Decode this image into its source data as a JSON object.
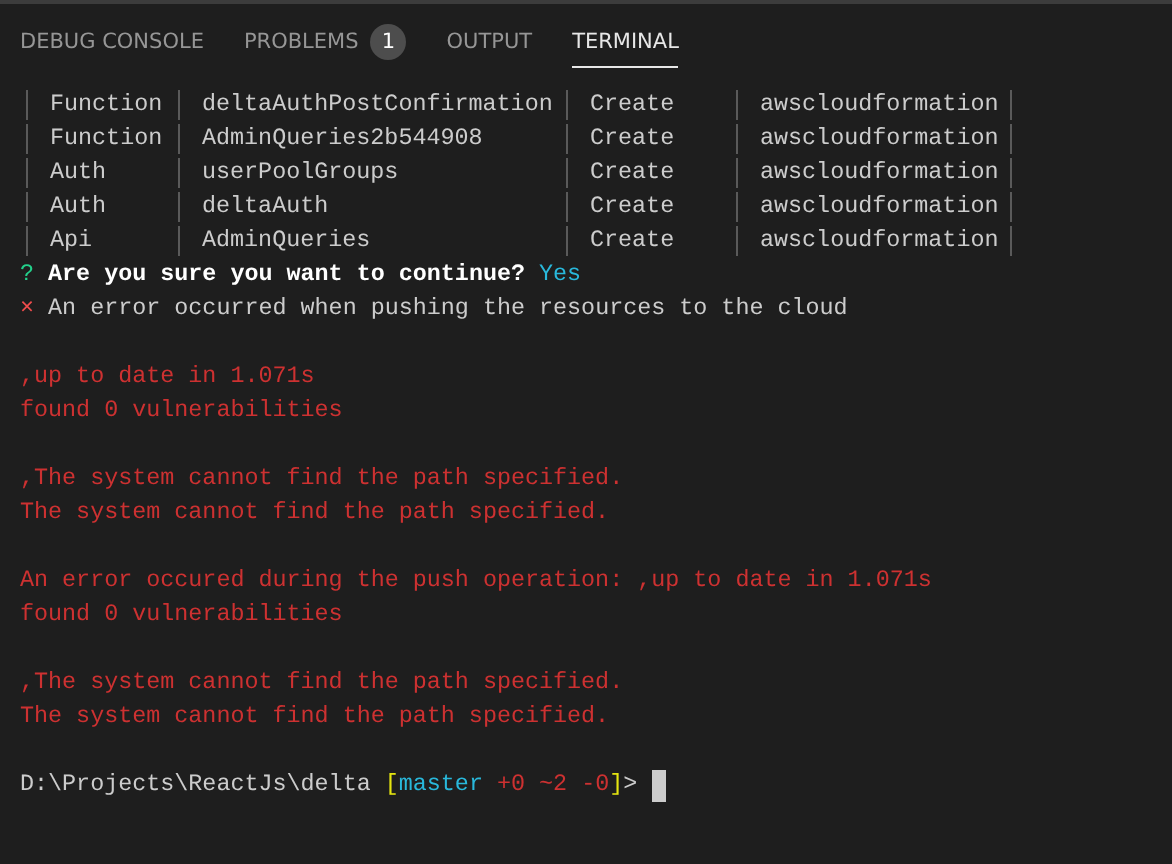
{
  "tabs": [
    {
      "label": "DEBUG CONSOLE",
      "selected": false
    },
    {
      "label": "PROBLEMS",
      "selected": false,
      "badge": "1"
    },
    {
      "label": "OUTPUT",
      "selected": false
    },
    {
      "label": "TERMINAL",
      "selected": true
    }
  ],
  "terminal": {
    "lines": [
      {
        "kind": "table_row",
        "cells": [
          "Function",
          "deltaAuthPostConfirmation",
          "Create",
          "awscloudformation"
        ]
      },
      {
        "kind": "table_row",
        "cells": [
          "Function",
          "AdminQueries2b544908",
          "Create",
          "awscloudformation"
        ]
      },
      {
        "kind": "table_row",
        "cells": [
          "Auth",
          "userPoolGroups",
          "Create",
          "awscloudformation"
        ]
      },
      {
        "kind": "table_row",
        "cells": [
          "Auth",
          "deltaAuth",
          "Create",
          "awscloudformation"
        ]
      },
      {
        "kind": "table_row",
        "cells": [
          "Api",
          "AdminQueries",
          "Create",
          "awscloudformation"
        ]
      },
      {
        "kind": "question",
        "mark": "?",
        "question": "Are you sure you want to continue?",
        "answer": "Yes"
      },
      {
        "kind": "failure",
        "mark": "×",
        "text": "An error occurred when pushing the resources to the cloud"
      },
      {
        "kind": "blank"
      },
      {
        "kind": "error",
        "text": ",up to date in 1.071s"
      },
      {
        "kind": "error",
        "text": "found 0 vulnerabilities"
      },
      {
        "kind": "blank"
      },
      {
        "kind": "error",
        "text": ",The system cannot find the path specified."
      },
      {
        "kind": "error",
        "text": "The system cannot find the path specified."
      },
      {
        "kind": "blank"
      },
      {
        "kind": "error",
        "text": "An error occured during the push operation: ,up to date in 1.071s"
      },
      {
        "kind": "error",
        "text": "found 0 vulnerabilities"
      },
      {
        "kind": "blank"
      },
      {
        "kind": "error",
        "text": ",The system cannot find the path specified."
      },
      {
        "kind": "error",
        "text": "The system cannot find the path specified."
      },
      {
        "kind": "blank"
      },
      {
        "kind": "shell_prompt",
        "segments": [
          {
            "text": "D:\\Projects\\ReactJs\\delta ",
            "color": "#cccccc"
          },
          {
            "text": "[",
            "color": "#e5e510"
          },
          {
            "text": "master",
            "color": "#29b8db"
          },
          {
            "text": " +0 ~2 -0",
            "color": "#cd3131"
          },
          {
            "text": "]",
            "color": "#e5e510"
          },
          {
            "text": ">",
            "color": "#cccccc"
          }
        ]
      }
    ]
  }
}
